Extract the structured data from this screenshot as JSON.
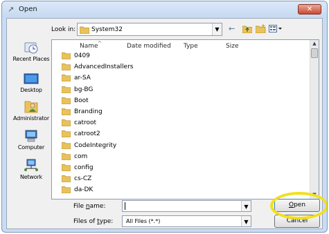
{
  "window": {
    "title": "Open",
    "title_icon": "open-dialog-icon",
    "close_label": "✕"
  },
  "toolbar": {
    "lookin_label": "Look in:",
    "lookin_value": "System32",
    "back_icon": "back-arrow-icon",
    "up_icon": "up-folder-icon",
    "new_folder_icon": "new-folder-icon",
    "views_icon": "views-menu-icon"
  },
  "places": [
    {
      "label": "Recent Places",
      "icon": "recent-places-icon"
    },
    {
      "label": "Desktop",
      "icon": "desktop-icon"
    },
    {
      "label": "Administrator",
      "icon": "user-folder-icon"
    },
    {
      "label": "Computer",
      "icon": "computer-icon"
    },
    {
      "label": "Network",
      "icon": "network-icon"
    }
  ],
  "columns": [
    "Name",
    "Date modified",
    "Type",
    "Size"
  ],
  "files": [
    "0409",
    "AdvancedInstallers",
    "ar-SA",
    "bg-BG",
    "Boot",
    "Branding",
    "catroot",
    "catroot2",
    "CodeIntegrity",
    "com",
    "config",
    "cs-CZ",
    "da-DK"
  ],
  "form": {
    "filename_label_prefix": "File ",
    "filename_label_key": "n",
    "filename_label_suffix": "ame:",
    "filename_value": "",
    "filetype_label_prefix": "Files of ",
    "filetype_label_key": "t",
    "filetype_label_suffix": "ype:",
    "filetype_value": "All Files (*.*)"
  },
  "buttons": {
    "open_key": "O",
    "open_rest": "pen",
    "cancel": "Cancel"
  },
  "colors": {
    "frame": "#c9dcf2",
    "highlight_ring": "#f2e01b",
    "folder": "#e9c25c"
  }
}
